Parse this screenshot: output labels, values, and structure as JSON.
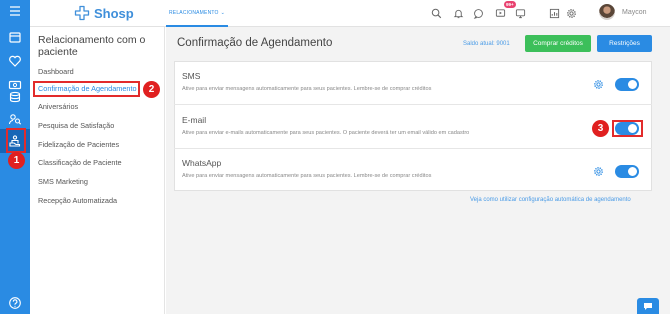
{
  "topbar": {
    "logo": "Shosp",
    "tab_label": "RELACIONAMENTO",
    "tab_chevron": "⌄",
    "notif_badge": "99+",
    "user_name": "Maycon"
  },
  "sidebar": {
    "title": "Relacionamento com o paciente",
    "items": [
      "Dashboard",
      "Confirmação de Agendamento",
      "Aniversários",
      "Pesquisa de Satisfação",
      "Fidelização de Pacientes",
      "Classificação de Paciente",
      "SMS Marketing",
      "Recepção Automatizada"
    ],
    "active_index": 1
  },
  "main": {
    "title": "Confirmação de Agendamento",
    "saldo": "Saldo atual: 9001",
    "buy_button": "Comprar créditos",
    "restrictions_button": "Restrições",
    "channels": [
      {
        "name": "SMS",
        "description": "Ative para enviar mensagens automaticamente para seus pacientes. Lembre-se de comprar créditos",
        "enabled": true
      },
      {
        "name": "E-mail",
        "description": "Ative para enviar e-mails automaticamente para seus pacientes. O paciente deverá ter um email válido em cadastro",
        "enabled": true
      },
      {
        "name": "WhatsApp",
        "description": "Ative para enviar mensagens automaticamente para seus pacientes. Lembre-se de comprar créditos",
        "enabled": true
      }
    ],
    "help_link": "Veja como utilizar configuração automática de agendamento"
  },
  "annotations": {
    "marker_1": "1",
    "marker_2": "2",
    "marker_3": "3"
  },
  "colors": {
    "primary": "#2a8be3",
    "success": "#3cbf5a",
    "highlight": "#e22b2b",
    "badge": "#e94270"
  },
  "icons": {
    "rail": [
      "menu-icon",
      "calendar-icon",
      "heart-icon",
      "money-icon",
      "database-icon",
      "users-search-icon",
      "relationship-icon",
      "help-icon"
    ],
    "topbar": [
      "search-icon",
      "bell-icon",
      "chat-icon",
      "video-icon",
      "monitor-icon",
      "reports-icon",
      "settings-icon"
    ]
  }
}
